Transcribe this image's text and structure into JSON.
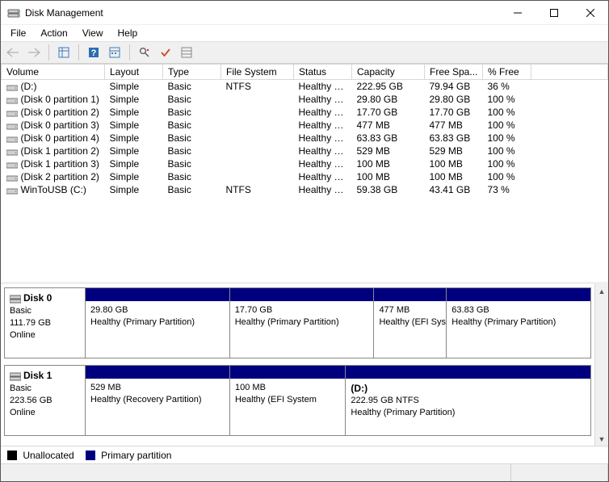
{
  "window": {
    "title": "Disk Management"
  },
  "menu": {
    "file": "File",
    "action": "Action",
    "view": "View",
    "help": "Help"
  },
  "columns": {
    "volume": "Volume",
    "layout": "Layout",
    "type": "Type",
    "fs": "File System",
    "status": "Status",
    "capacity": "Capacity",
    "free": "Free Spa...",
    "pct": "% Free"
  },
  "volumes": [
    {
      "name": "(D:)",
      "layout": "Simple",
      "type": "Basic",
      "fs": "NTFS",
      "status": "Healthy (P...",
      "capacity": "222.95 GB",
      "free": "79.94 GB",
      "pct": "36 %"
    },
    {
      "name": "(Disk 0 partition 1)",
      "layout": "Simple",
      "type": "Basic",
      "fs": "",
      "status": "Healthy (P...",
      "capacity": "29.80 GB",
      "free": "29.80 GB",
      "pct": "100 %"
    },
    {
      "name": "(Disk 0 partition 2)",
      "layout": "Simple",
      "type": "Basic",
      "fs": "",
      "status": "Healthy (P...",
      "capacity": "17.70 GB",
      "free": "17.70 GB",
      "pct": "100 %"
    },
    {
      "name": "(Disk 0 partition 3)",
      "layout": "Simple",
      "type": "Basic",
      "fs": "",
      "status": "Healthy (E...",
      "capacity": "477 MB",
      "free": "477 MB",
      "pct": "100 %"
    },
    {
      "name": "(Disk 0 partition 4)",
      "layout": "Simple",
      "type": "Basic",
      "fs": "",
      "status": "Healthy (P...",
      "capacity": "63.83 GB",
      "free": "63.83 GB",
      "pct": "100 %"
    },
    {
      "name": "(Disk 1 partition 2)",
      "layout": "Simple",
      "type": "Basic",
      "fs": "",
      "status": "Healthy (R...",
      "capacity": "529 MB",
      "free": "529 MB",
      "pct": "100 %"
    },
    {
      "name": "(Disk 1 partition 3)",
      "layout": "Simple",
      "type": "Basic",
      "fs": "",
      "status": "Healthy (E...",
      "capacity": "100 MB",
      "free": "100 MB",
      "pct": "100 %"
    },
    {
      "name": "(Disk 2 partition 2)",
      "layout": "Simple",
      "type": "Basic",
      "fs": "",
      "status": "Healthy (E...",
      "capacity": "100 MB",
      "free": "100 MB",
      "pct": "100 %"
    },
    {
      "name": "WinToUSB (C:)",
      "layout": "Simple",
      "type": "Basic",
      "fs": "NTFS",
      "status": "Healthy (B...",
      "capacity": "59.38 GB",
      "free": "43.41 GB",
      "pct": "73 %"
    }
  ],
  "disks": [
    {
      "label": "Disk 0",
      "type": "Basic",
      "size": "111.79 GB",
      "status": "Online",
      "parts": [
        {
          "title": "",
          "size": "29.80 GB",
          "status": "Healthy (Primary Partition)",
          "flex": 2
        },
        {
          "title": "",
          "size": "17.70 GB",
          "status": "Healthy (Primary Partition)",
          "flex": 2
        },
        {
          "title": "",
          "size": "477 MB",
          "status": "Healthy (EFI Sys",
          "flex": 1
        },
        {
          "title": "",
          "size": "63.83 GB",
          "status": "Healthy (Primary Partition)",
          "flex": 2
        }
      ]
    },
    {
      "label": "Disk 1",
      "type": "Basic",
      "size": "223.56 GB",
      "status": "Online",
      "parts": [
        {
          "title": "",
          "size": "529 MB",
          "status": "Healthy (Recovery Partition)",
          "flex": 2
        },
        {
          "title": "",
          "size": "100 MB",
          "status": "Healthy (EFI System",
          "flex": 1.6
        },
        {
          "title": "(D:)",
          "size": "222.95 GB NTFS",
          "status": "Healthy (Primary Partition)",
          "flex": 3.4
        }
      ]
    }
  ],
  "legend": {
    "unallocated": "Unallocated",
    "primary": "Primary partition"
  },
  "colors": {
    "stripe": "#00007f",
    "unallocated": "#000000"
  }
}
